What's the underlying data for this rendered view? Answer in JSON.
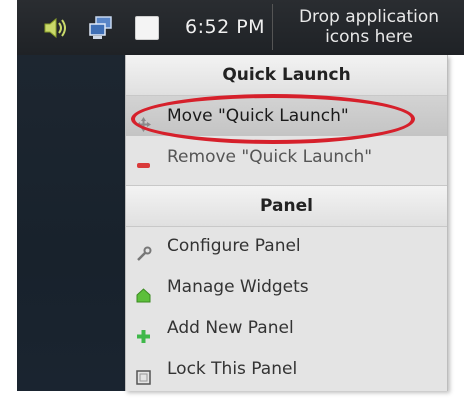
{
  "panel": {
    "clock": "6:52 PM",
    "drop_zone_line1": "Drop application",
    "drop_zone_line2": "icons here",
    "icons": [
      "volume-icon",
      "network-icon",
      "window-icon"
    ]
  },
  "menu": {
    "section_quick_launch": "Quick Launch",
    "items_quick_launch": [
      {
        "label": "Move \"Quick Launch\"",
        "icon": "move-icon"
      },
      {
        "label": "Remove \"Quick Launch\"",
        "icon": "remove-icon"
      }
    ],
    "section_panel": "Panel",
    "items_panel": [
      {
        "label": "Configure Panel",
        "icon": "configure-icon"
      },
      {
        "label": "Manage Widgets",
        "icon": "widgets-icon"
      },
      {
        "label": "Add New Panel",
        "icon": "add-icon"
      },
      {
        "label": "Lock This Panel",
        "icon": "lock-icon"
      }
    ]
  },
  "colors": {
    "highlight": "#d6202b",
    "panel_bg": "#2a2d31",
    "menu_bg": "#e4e4e4"
  }
}
